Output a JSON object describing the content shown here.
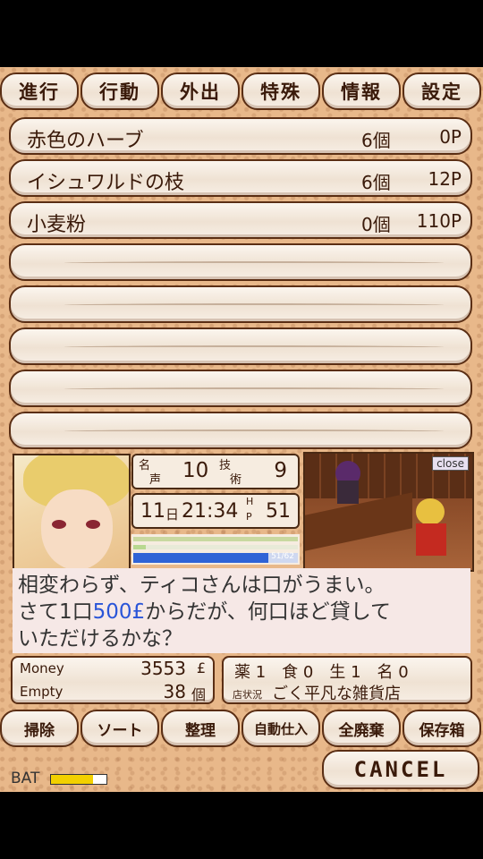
{
  "tabs": [
    "進行",
    "行動",
    "外出",
    "特殊",
    "情報",
    "設定"
  ],
  "items": [
    {
      "name": "赤色のハーブ",
      "qty": "6個",
      "price": "0P"
    },
    {
      "name": "イシュワルドの枝",
      "qty": "6個",
      "price": "12P"
    },
    {
      "name": "小麦粉",
      "qty": "0個",
      "price": "110P"
    }
  ],
  "stats": {
    "fame_label_top": "名",
    "fame_label_bot": "声",
    "fame": "10",
    "skill_label_top": "技",
    "skill_label_bot": "術",
    "skill": "9",
    "day": "11",
    "day_unit": "日",
    "time": "21:34",
    "hp_label_top": "H",
    "hp_label_bot": "P",
    "hp": "51",
    "hp_bar_text": "51/62",
    "hp_fraction": 0.82
  },
  "scene": {
    "close_label": "close"
  },
  "message": {
    "line1": "相変わらず、ティコさんは口がうまい。",
    "line2_pre": "さて1口",
    "line2_amount": "500£",
    "line2_post": "からだが、何口ほど貸して",
    "line3": "いただけるかな？"
  },
  "money": {
    "money_label": "Money",
    "money_value": "3553",
    "money_unit": "£",
    "empty_label": "Empty",
    "empty_value": "38",
    "empty_unit": "個"
  },
  "status": {
    "line1": "薬 1　食 0　生 1　名 0",
    "shop_label": "店状況",
    "shop_value": "ごく平凡な雑貨店"
  },
  "bottom_tabs": [
    "掃除",
    "ソート",
    "整理",
    "自動仕入",
    "全廃棄",
    "保存箱"
  ],
  "cancel_label": "CANCEL",
  "battery": {
    "label": "BAT",
    "level": 0.75
  },
  "colors": {
    "wood": "#efe2d3",
    "border": "#5a2e14",
    "hp_bar": "#2f63d6",
    "accent_blue": "#2a55d8"
  }
}
